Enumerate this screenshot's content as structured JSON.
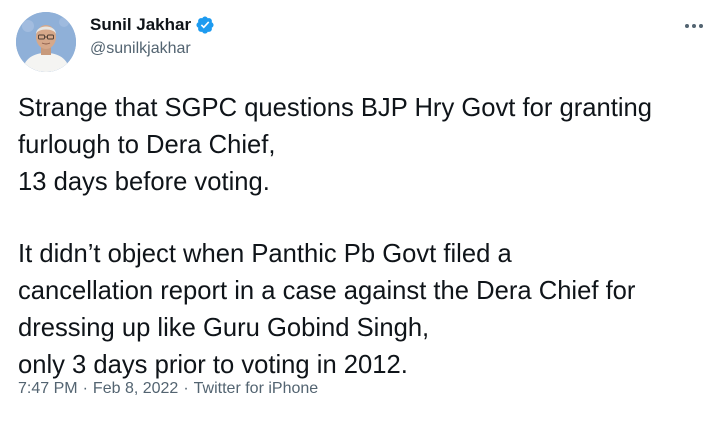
{
  "author": {
    "display_name": "Sunil Jakhar",
    "handle": "@sunilkjakhar",
    "verified": true
  },
  "icons": {
    "verified": "verified-badge-icon",
    "more": "more-options-icon"
  },
  "tweet": {
    "paragraph1_line1": "Strange that SGPC questions BJP Hry Govt for granting",
    "paragraph1_line2": "furlough to Dera Chief,",
    "paragraph1_line3": "13 days before voting.",
    "paragraph2_line1": "It didn’t object when Panthic Pb Govt filed a",
    "paragraph2_line2": "cancellation report in a case against the Dera Chief for",
    "paragraph2_line3": "dressing up like Guru Gobind Singh,",
    "paragraph2_line4": "only 3 days prior to voting in 2012."
  },
  "meta": {
    "time": "7:47 PM",
    "separator": "·",
    "date": "Feb 8, 2022",
    "source": "Twitter for iPhone"
  },
  "colors": {
    "text": "#0f1419",
    "secondary": "#536471",
    "verified_blue": "#1d9bf0"
  }
}
